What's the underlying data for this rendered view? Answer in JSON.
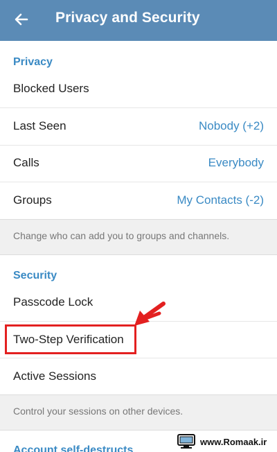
{
  "header": {
    "title": "Privacy and Security",
    "back_icon": "back-arrow-icon",
    "bar_color": "#5b8bb6"
  },
  "privacy": {
    "header": "Privacy",
    "items": [
      {
        "label": "Blocked Users",
        "value": ""
      },
      {
        "label": "Last Seen",
        "value": "Nobody (+2)"
      },
      {
        "label": "Calls",
        "value": "Everybody"
      },
      {
        "label": "Groups",
        "value": "My Contacts (-2)"
      }
    ],
    "hint": "Change who can add you to groups and channels."
  },
  "security": {
    "header": "Security",
    "items": [
      {
        "label": "Passcode Lock"
      },
      {
        "label": "Two-Step Verification"
      },
      {
        "label": "Active Sessions"
      }
    ],
    "hint": "Control your sessions on other devices."
  },
  "account": {
    "header": "Account self-destructs"
  },
  "annotation": {
    "arrow_icon": "red-arrow-icon",
    "color": "#e32020"
  },
  "watermark": {
    "text": "www.Romaak.ir",
    "logo_icon": "computer-logo-icon"
  },
  "accent_color": "#3a8ac4"
}
